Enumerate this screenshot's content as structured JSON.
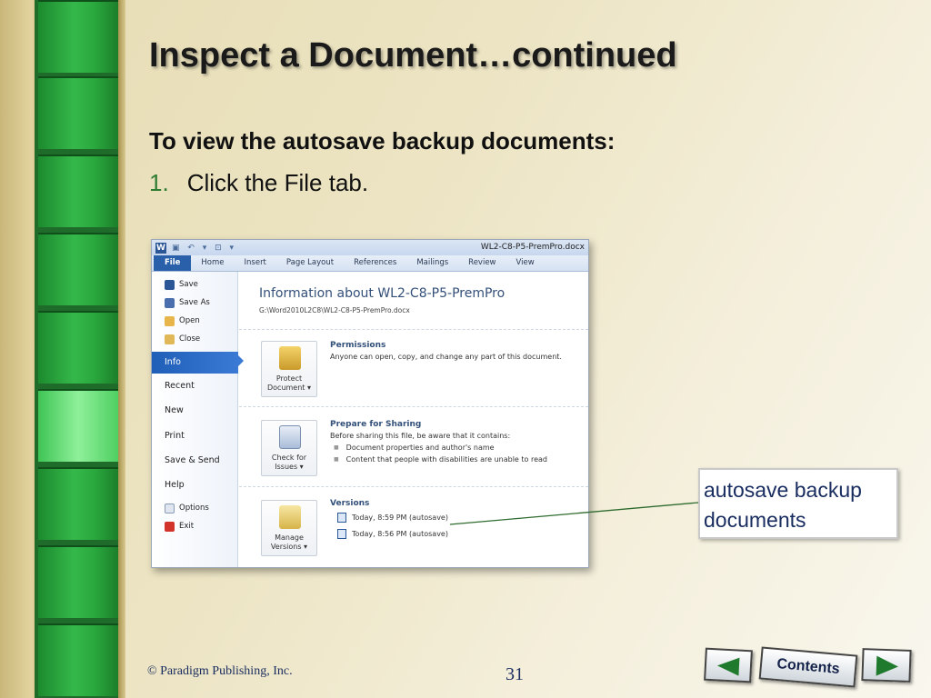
{
  "slide": {
    "title": "Inspect a Document…continued",
    "subhead": "To view the autosave backup documents:",
    "step_number": "1.",
    "step_text": "Click the File tab.",
    "callout": "autosave backup documents",
    "copyright": "© Paradigm Publishing, Inc.",
    "page_number": "31",
    "nav_contents": "Contents"
  },
  "word": {
    "app_letter": "W",
    "qat": "▣ ↶ ▾ ⊡ ▾",
    "doc_name": "WL2-C8-P5-PremPro.docx",
    "tabs": [
      "File",
      "Home",
      "Insert",
      "Page Layout",
      "References",
      "Mailings",
      "Review",
      "View"
    ],
    "menu": {
      "save": "Save",
      "save_as": "Save As",
      "open": "Open",
      "close": "Close",
      "info": "Info",
      "recent": "Recent",
      "new": "New",
      "print": "Print",
      "save_send": "Save & Send",
      "help": "Help",
      "options": "Options",
      "exit": "Exit"
    },
    "info_title": "Information about WL2-C8-P5-PremPro",
    "info_path": "G:\\Word2010L2C8\\WL2-C8-P5-PremPro.docx",
    "permissions": {
      "button_line1": "Protect",
      "button_line2": "Document ▾",
      "heading": "Permissions",
      "text": "Anyone can open, copy, and change any part of this document."
    },
    "sharing": {
      "button_line1": "Check for",
      "button_line2": "Issues ▾",
      "heading": "Prepare for Sharing",
      "text": "Before sharing this file, be aware that it contains:",
      "bullets": [
        "Document properties and author's name",
        "Content that people with disabilities are unable to read"
      ]
    },
    "versions": {
      "button_line1": "Manage",
      "button_line2": "Versions ▾",
      "heading": "Versions",
      "items": [
        "Today, 8:59 PM (autosave)",
        "Today, 8:56 PM (autosave)"
      ]
    }
  },
  "colors": {
    "accent_green": "#2e7d32",
    "word_blue": "#2a5fa9",
    "text_navy": "#1a2d60"
  }
}
